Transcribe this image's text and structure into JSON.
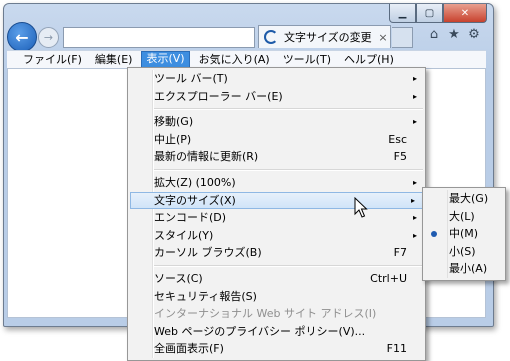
{
  "browser": {
    "tab_title": "文字サイズの変更",
    "tab_close": "×",
    "title_buttons": {
      "minimize": "▁",
      "maximize": "▢",
      "close": "✕"
    },
    "tools": [
      "⌂",
      "★",
      "⚙"
    ],
    "nav": {
      "back": "←",
      "forward": "→"
    }
  },
  "menubar": {
    "items": [
      {
        "label": "ファイル(F)"
      },
      {
        "label": "編集(E)"
      },
      {
        "label": "表示(V)"
      },
      {
        "label": "お気に入り(A)"
      },
      {
        "label": "ツール(T)"
      },
      {
        "label": "ヘルプ(H)"
      }
    ]
  },
  "view_menu": {
    "items": [
      {
        "label": "ツール バー(T)",
        "shortcut": "",
        "submenu": true
      },
      {
        "label": "エクスプローラー バー(E)",
        "shortcut": "",
        "submenu": true
      },
      {
        "label": "移動(G)",
        "shortcut": "",
        "submenu": true
      },
      {
        "label": "中止(P)",
        "shortcut": "Esc",
        "submenu": false
      },
      {
        "label": "最新の情報に更新(R)",
        "shortcut": "F5",
        "submenu": false
      },
      {
        "label": "拡大(Z) (100%)",
        "shortcut": "",
        "submenu": true
      },
      {
        "label": "文字のサイズ(X)",
        "shortcut": "",
        "submenu": true
      },
      {
        "label": "エンコード(D)",
        "shortcut": "",
        "submenu": true
      },
      {
        "label": "スタイル(Y)",
        "shortcut": "",
        "submenu": true
      },
      {
        "label": "カーソル ブラウズ(B)",
        "shortcut": "F7",
        "submenu": false
      },
      {
        "label": "ソース(C)",
        "shortcut": "Ctrl+U",
        "submenu": false
      },
      {
        "label": "セキュリティ報告(S)",
        "shortcut": "",
        "submenu": false
      },
      {
        "label": "インターナショナル Web サイト アドレス(I)",
        "shortcut": "",
        "submenu": false
      },
      {
        "label": "Web ページのプライバシー ポリシー(V)...",
        "shortcut": "",
        "submenu": false
      },
      {
        "label": "全画面表示(F)",
        "shortcut": "F11",
        "submenu": false
      }
    ]
  },
  "text_size_submenu": {
    "items": [
      {
        "label": "最大(G)"
      },
      {
        "label": "大(L)"
      },
      {
        "label": "中(M)"
      },
      {
        "label": "小(S)"
      },
      {
        "label": "最小(A)"
      }
    ]
  },
  "arrow": "▸",
  "colors": {
    "accent": "#3d8ee0",
    "highlight": "#cfe3f8"
  }
}
